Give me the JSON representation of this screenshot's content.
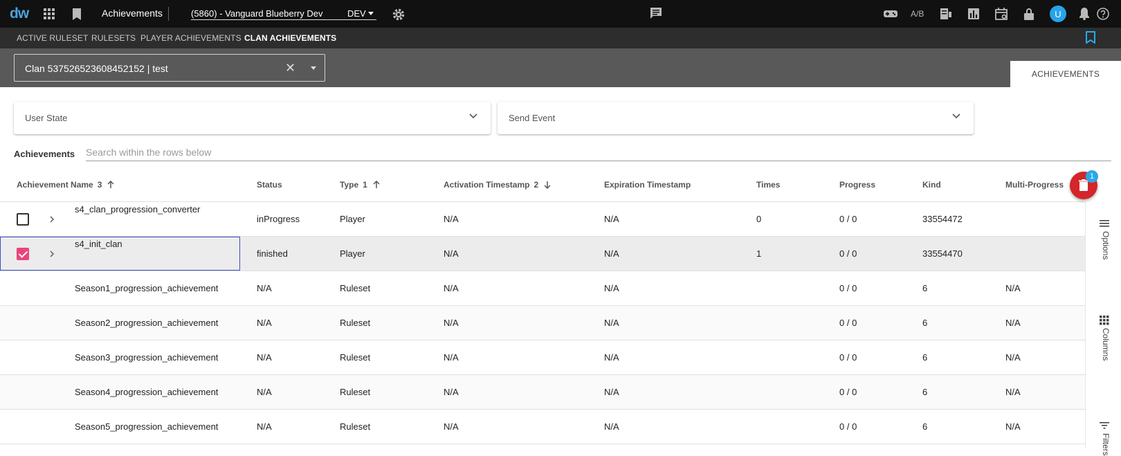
{
  "topbar": {
    "logo": "dw",
    "app_title": "Achievements",
    "project": "(5860) - Vanguard Blueberry Dev",
    "environment": "DEV",
    "ab_label": "A/B",
    "avatar_letter": "U"
  },
  "nav": {
    "items": [
      "ACTIVE RULESET",
      "RULESETS",
      "PLAYER ACHIEVEMENTS",
      "CLAN ACHIEVEMENTS"
    ],
    "active": "CLAN ACHIEVEMENTS"
  },
  "clan_select": {
    "value": "Clan 537526523608452152 | test"
  },
  "tabs": {
    "achievements": "ACHIEVEMENTS"
  },
  "panels": {
    "user_state": "User State",
    "send_event": "Send Event"
  },
  "search": {
    "label": "Achievements",
    "placeholder": "Search within the rows below"
  },
  "table": {
    "columns": [
      {
        "label": "Achievement Name",
        "sort_index": "3",
        "sort_dir": "asc"
      },
      {
        "label": "Status",
        "sort_index": "",
        "sort_dir": ""
      },
      {
        "label": "Type",
        "sort_index": "1",
        "sort_dir": "asc"
      },
      {
        "label": "Activation Timestamp",
        "sort_index": "2",
        "sort_dir": "desc"
      },
      {
        "label": "Expiration Timestamp",
        "sort_index": "",
        "sort_dir": ""
      },
      {
        "label": "Times",
        "sort_index": "",
        "sort_dir": ""
      },
      {
        "label": "Progress",
        "sort_index": "",
        "sort_dir": ""
      },
      {
        "label": "Kind",
        "sort_index": "",
        "sort_dir": ""
      },
      {
        "label": "Multi-Progress",
        "sort_index": "",
        "sort_dir": ""
      }
    ],
    "rows": [
      {
        "name": "s4_clan_progression_converter",
        "status": "inProgress",
        "type": "Player",
        "activation": "N/A",
        "expiration": "N/A",
        "times": "0",
        "progress": "0 / 0",
        "kind": "33554472",
        "multi": "",
        "checkbox": true,
        "checked": false
      },
      {
        "name": "s4_init_clan",
        "status": "finished",
        "type": "Player",
        "activation": "N/A",
        "expiration": "N/A",
        "times": "1",
        "progress": "0 / 0",
        "kind": "33554470",
        "multi": "",
        "checkbox": true,
        "checked": true
      },
      {
        "name": "Season1_progression_achievement",
        "status": "N/A",
        "type": "Ruleset",
        "activation": "N/A",
        "expiration": "N/A",
        "times": "",
        "progress": "0 / 0",
        "kind": "6",
        "multi": "N/A",
        "checkbox": false,
        "checked": false
      },
      {
        "name": "Season2_progression_achievement",
        "status": "N/A",
        "type": "Ruleset",
        "activation": "N/A",
        "expiration": "N/A",
        "times": "",
        "progress": "0 / 0",
        "kind": "6",
        "multi": "N/A",
        "checkbox": false,
        "checked": false
      },
      {
        "name": "Season3_progression_achievement",
        "status": "N/A",
        "type": "Ruleset",
        "activation": "N/A",
        "expiration": "N/A",
        "times": "",
        "progress": "0 / 0",
        "kind": "6",
        "multi": "N/A",
        "checkbox": false,
        "checked": false
      },
      {
        "name": "Season4_progression_achievement",
        "status": "N/A",
        "type": "Ruleset",
        "activation": "N/A",
        "expiration": "N/A",
        "times": "",
        "progress": "0 / 0",
        "kind": "6",
        "multi": "N/A",
        "checkbox": false,
        "checked": false
      },
      {
        "name": "Season5_progression_achievement",
        "status": "N/A",
        "type": "Ruleset",
        "activation": "N/A",
        "expiration": "N/A",
        "times": "",
        "progress": "0 / 0",
        "kind": "6",
        "multi": "N/A",
        "checkbox": false,
        "checked": false
      }
    ]
  },
  "side_panel": {
    "options": "Options",
    "columns": "Columns",
    "filters": "Filters"
  },
  "fab": {
    "badge": "1"
  },
  "colors": {
    "accent": "#29a8e8",
    "checkbox": "#e8457c",
    "fab": "#d3252a"
  }
}
